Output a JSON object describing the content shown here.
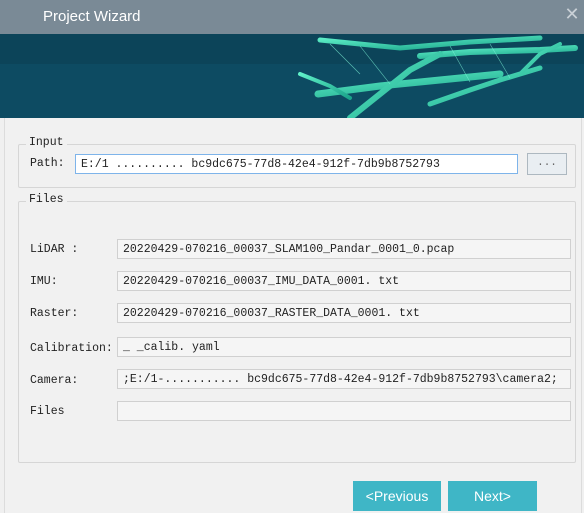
{
  "window": {
    "title": "Project Wizard",
    "close_icon": "✕"
  },
  "input_group": {
    "legend": "Input",
    "path_label": "Path:",
    "path_value": "E:/1 ..........   bc9dc675-77d8-42e4-912f-7db9b8752793",
    "browse_label": "..."
  },
  "files_group": {
    "legend": "Files",
    "rows": [
      {
        "label": "LiDAR :",
        "value": "20220429-070216_00037_SLAM100_Pandar_0001_0.pcap"
      },
      {
        "label": "IMU:",
        "value": "20220429-070216_00037_IMU_DATA_0001. txt"
      },
      {
        "label": "Raster:",
        "value": "20220429-070216_00037_RASTER_DATA_0001. txt"
      },
      {
        "label": "Calibration:",
        "value": "_          _calib. yaml"
      },
      {
        "label": "Camera:",
        "value": ";E:/1-...........   bc9dc675-77d8-42e4-912f-7db9b8752793\\camera2;"
      },
      {
        "label": "Files",
        "value": ""
      }
    ]
  },
  "buttons": {
    "previous": "<Previous",
    "next": "Next>"
  },
  "colors": {
    "titlebar": "#7a8a96",
    "accent_button": "#3fb6c6",
    "banner": "#0f5a73"
  }
}
